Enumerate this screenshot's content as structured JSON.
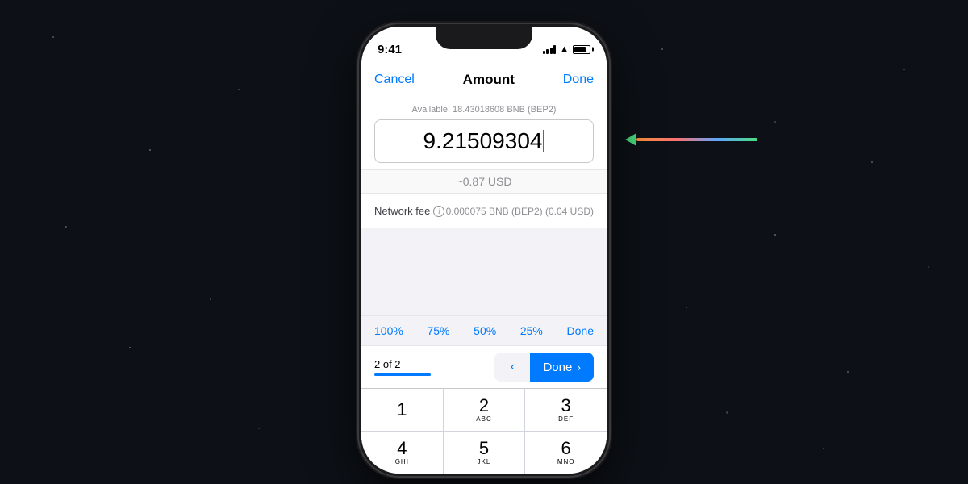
{
  "background": {
    "color": "#0d1117"
  },
  "phone": {
    "status_bar": {
      "time": "9:41",
      "battery_level": 80
    },
    "header": {
      "cancel_label": "Cancel",
      "title": "Amount",
      "done_label": "Done"
    },
    "amount_section": {
      "available_text": "Available: 18.43018608 BNB (BEP2)",
      "amount_value": "9.21509304",
      "usd_amount": "~0.87 USD"
    },
    "network_fee": {
      "label": "Network fee",
      "value": "0.000075 BNB (BEP2) (0.04 USD)"
    },
    "percent_options": [
      "100%",
      "75%",
      "50%",
      "25%",
      "Done"
    ],
    "step_indicator": {
      "text": "2 of 2",
      "back_label": "<",
      "done_label": "Done",
      "chevron": ">"
    },
    "keypad": [
      {
        "number": "1",
        "letters": ""
      },
      {
        "number": "2",
        "letters": "ABC"
      },
      {
        "number": "3",
        "letters": "DEF"
      },
      {
        "number": "4",
        "letters": "GHI"
      },
      {
        "number": "5",
        "letters": "JKL"
      },
      {
        "number": "6",
        "letters": "MNO"
      }
    ]
  },
  "arrow": {
    "direction": "left"
  }
}
